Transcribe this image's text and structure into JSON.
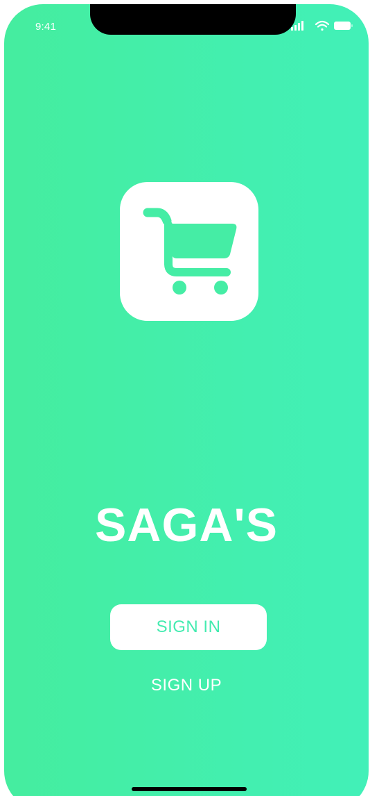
{
  "status_bar": {
    "time": "9:41",
    "icons": [
      "signal-icon",
      "wifi-icon",
      "battery-icon"
    ]
  },
  "logo": {
    "icon": "shopping-cart-icon"
  },
  "brand": {
    "name": "SAGA'S"
  },
  "actions": {
    "sign_in_label": "SIGN IN",
    "sign_up_label": "SIGN UP"
  },
  "colors": {
    "gradient_start": "#45ED9F",
    "gradient_end": "#42F0B8",
    "accent": "#44EBB0",
    "white": "#FFFFFF"
  }
}
